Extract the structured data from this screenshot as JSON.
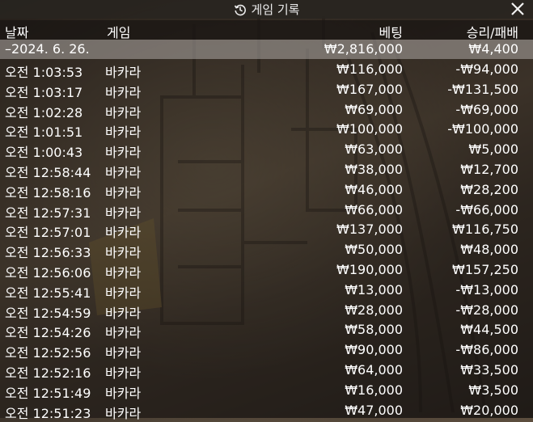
{
  "window": {
    "title": "게임 기록",
    "history_icon": "history-icon",
    "close_icon": "close-icon"
  },
  "columns": {
    "date": "날짜",
    "game": "게임",
    "bet": "베팅",
    "result": "승리/패배"
  },
  "date_group": {
    "date": "–2024. 6. 26.",
    "total_bet": "₩2,816,000",
    "total_result": "₩4,400"
  },
  "rows": [
    {
      "time": "오전 1:03:53",
      "game": "바카라",
      "bet": "₩116,000",
      "result": "-₩94,000"
    },
    {
      "time": "오전 1:03:17",
      "game": "바카라",
      "bet": "₩167,000",
      "result": "-₩131,500"
    },
    {
      "time": "오전 1:02:28",
      "game": "바카라",
      "bet": "₩69,000",
      "result": "-₩69,000"
    },
    {
      "time": "오전 1:01:51",
      "game": "바카라",
      "bet": "₩100,000",
      "result": "-₩100,000"
    },
    {
      "time": "오전 1:00:43",
      "game": "바카라",
      "bet": "₩63,000",
      "result": "₩5,000"
    },
    {
      "time": "오전 12:58:44",
      "game": "바카라",
      "bet": "₩38,000",
      "result": "₩12,700"
    },
    {
      "time": "오전 12:58:16",
      "game": "바카라",
      "bet": "₩46,000",
      "result": "₩28,200"
    },
    {
      "time": "오전 12:57:31",
      "game": "바카라",
      "bet": "₩66,000",
      "result": "-₩66,000"
    },
    {
      "time": "오전 12:57:01",
      "game": "바카라",
      "bet": "₩137,000",
      "result": "₩116,750"
    },
    {
      "time": "오전 12:56:33",
      "game": "바카라",
      "bet": "₩50,000",
      "result": "₩48,000"
    },
    {
      "time": "오전 12:56:06",
      "game": "바카라",
      "bet": "₩190,000",
      "result": "₩157,250"
    },
    {
      "time": "오전 12:55:41",
      "game": "바카라",
      "bet": "₩13,000",
      "result": "-₩13,000"
    },
    {
      "time": "오전 12:54:59",
      "game": "바카라",
      "bet": "₩28,000",
      "result": "-₩28,000"
    },
    {
      "time": "오전 12:54:26",
      "game": "바카라",
      "bet": "₩58,000",
      "result": "₩44,500"
    },
    {
      "time": "오전 12:52:56",
      "game": "바카라",
      "bet": "₩90,000",
      "result": "-₩86,000"
    },
    {
      "time": "오전 12:52:16",
      "game": "바카라",
      "bet": "₩64,000",
      "result": "₩33,500"
    },
    {
      "time": "오전 12:51:49",
      "game": "바카라",
      "bet": "₩16,000",
      "result": "₩3,500"
    },
    {
      "time": "오전 12:51:23",
      "game": "바카라",
      "bet": "₩47,000",
      "result": "₩20,000"
    }
  ]
}
